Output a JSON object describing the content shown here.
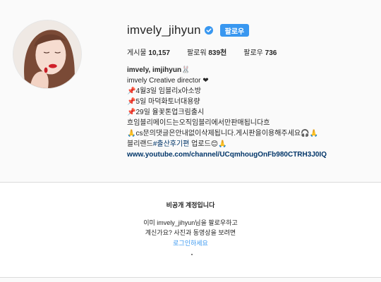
{
  "profile": {
    "username": "imvely_jihyun",
    "follow_label": "팔로우",
    "stats": {
      "posts_label": "게시물",
      "posts_value": "10,157",
      "followers_label": "팔로워",
      "followers_value": "839천",
      "following_label": "팔로우",
      "following_value": "736"
    },
    "bio": {
      "name": "imvely, imjihyun🐰",
      "lines": [
        "imvely Creative director ❤",
        "📌4월3일 임블리x아소방",
        "📌5일 마덕화토너대용량",
        "📌29일 율꽃톤업크림출시",
        "흐임블리메이드는오직임블리에서만판매됩니다흐",
        "🙏cs문의댓글은안내없이삭제됩니다.게시판을이용해주세요🎧🙏"
      ],
      "last_prefix": "블리랜드",
      "hashtag": "#출산후기편",
      "last_suffix": " 업로드😊🙏",
      "link": "www.youtube.com/channel/UCqmhougOnFb980CTRH3J0IQ"
    }
  },
  "private_account": {
    "title": "비공개 계정입니다",
    "desc_line1": "이미 imvely_jihyun님을 팔로우하고",
    "desc_line2": "계신가요? 사진과 동영상을 보려면",
    "login_label": "로그인하세요"
  },
  "colors": {
    "accent": "#3897f0",
    "link": "#003569",
    "verified": "#3897f0"
  }
}
